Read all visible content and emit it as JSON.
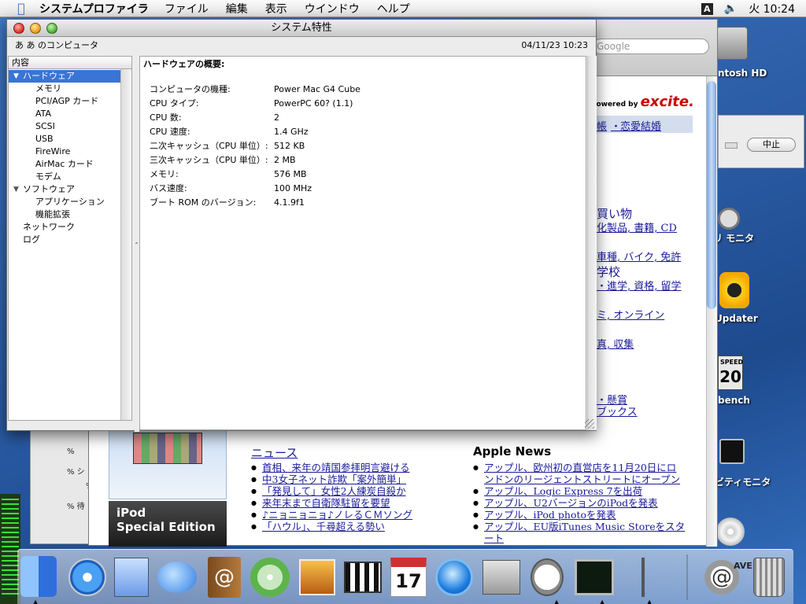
{
  "menubar": {
    "app_name": "システムプロファイラ",
    "items": [
      "ファイル",
      "編集",
      "表示",
      "ウインドウ",
      "ヘルプ"
    ],
    "input_method": "A",
    "clock": "火 10:24"
  },
  "background_browser": {
    "search_placeholder": "Google",
    "excite_prefix": "powered by",
    "excite_brand": "excite.",
    "band_links": [
      "帳",
      "恋愛結婚"
    ],
    "band_sep": "・",
    "right_links": [
      "買い物",
      "化製品, 書籍, CD",
      "車種, バイク, 免許",
      "学校",
      "・進学, 資格, 留学",
      "ミ, オンライン",
      "真, 収集",
      "・懸賞",
      "ブックス"
    ],
    "stop_button": "中止",
    "news_heading": "ニュース",
    "news_items": [
      "首相、来年の靖国参拝明言避ける",
      "中3女子ネット詐欺「案外簡単」",
      "「発見して」女性2人練炭自殺か",
      "来年末まで自衛隊駐留を要望",
      "♪ニョニョニョ♪ノレるＣＭソング",
      "「ハウル」、千尋超える勢い"
    ],
    "apple_heading": "Apple News",
    "apple_items": [
      "アップル、欧州初の直営店を11月20日にロンドンのリージェントストリートにオープン",
      "アップル、Logic Express 7を出荷",
      "アップル、U2バージョンのiPodを発表",
      "アップル、iPod photoを発表",
      "アップル、EU版iTunes Music Storeをスタート"
    ],
    "ipod_ad": [
      "iPod",
      "Special Edition"
    ],
    "gray_window_labels": [
      "% ",
      "% シ",
      "%",
      "% 待"
    ]
  },
  "desktop_icons": [
    {
      "name": "hard-disk",
      "label": "ntosh HD"
    },
    {
      "name": "clock",
      "label": "リ モニタ"
    },
    {
      "name": "updater",
      "label": "Updater"
    },
    {
      "name": "xbench",
      "label": "bench"
    },
    {
      "name": "activity-monitor",
      "label": "ビティモニタ"
    }
  ],
  "speed_icon_text": "20",
  "speed_icon_caption": "SPEED",
  "window": {
    "title": "システム特性",
    "computer_name": "あ あ のコンピュータ",
    "timestamp": "04/11/23 10:23",
    "sidebar_header": "内容",
    "tree": [
      {
        "label": "ハードウェア",
        "level": 0,
        "selected": true,
        "disclosure": true
      },
      {
        "label": "メモリ",
        "level": 1
      },
      {
        "label": "PCI/AGP カード",
        "level": 1
      },
      {
        "label": "ATA",
        "level": 1
      },
      {
        "label": "SCSI",
        "level": 1
      },
      {
        "label": "USB",
        "level": 1
      },
      {
        "label": "FireWire",
        "level": 1
      },
      {
        "label": "AirMac カード",
        "level": 1
      },
      {
        "label": "モデム",
        "level": 1
      },
      {
        "label": "ソフトウェア",
        "level": 0,
        "disclosure": true
      },
      {
        "label": "アプリケーション",
        "level": 1
      },
      {
        "label": "機能拡張",
        "level": 1
      },
      {
        "label": "ネットワーク",
        "level": 0
      },
      {
        "label": "ログ",
        "level": 0
      }
    ],
    "detail_heading": "ハードウェアの概要:",
    "details": [
      {
        "key": "コンピュータの機種:",
        "value": "Power Mac G4 Cube"
      },
      {
        "key": "CPU タイプ:",
        "value": "PowerPC 60?  (1.1)"
      },
      {
        "key": "CPU 数:",
        "value": "2"
      },
      {
        "key": "CPU 速度:",
        "value": "1.4 GHz"
      },
      {
        "key": "二次キャッシュ（CPU 単位）:",
        "value": "512 KB"
      },
      {
        "key": "三次キャッシュ（CPU 単位）:",
        "value": "2 MB"
      },
      {
        "key": "メモリ:",
        "value": "576 MB"
      },
      {
        "key": "バス速度:",
        "value": "100 MHz"
      },
      {
        "key": "ブート ROM のバージョン:",
        "value": "4.1.9f1"
      }
    ]
  },
  "dock": {
    "items": [
      "Finder",
      "Safari",
      "Mail",
      "iChat",
      "アドレスブック",
      "iTunes",
      "iPhoto",
      "iMovie",
      "iCal",
      "QuickTime Player",
      "システム環境設定",
      "ストップウォッチ",
      "アクティビティモニタ",
      "システムプロファイラ",
      "Mail Server",
      "ゴミ箱"
    ],
    "ical_date": "17",
    "ical_month": "JUL",
    "dock_label_right": "AVE"
  }
}
